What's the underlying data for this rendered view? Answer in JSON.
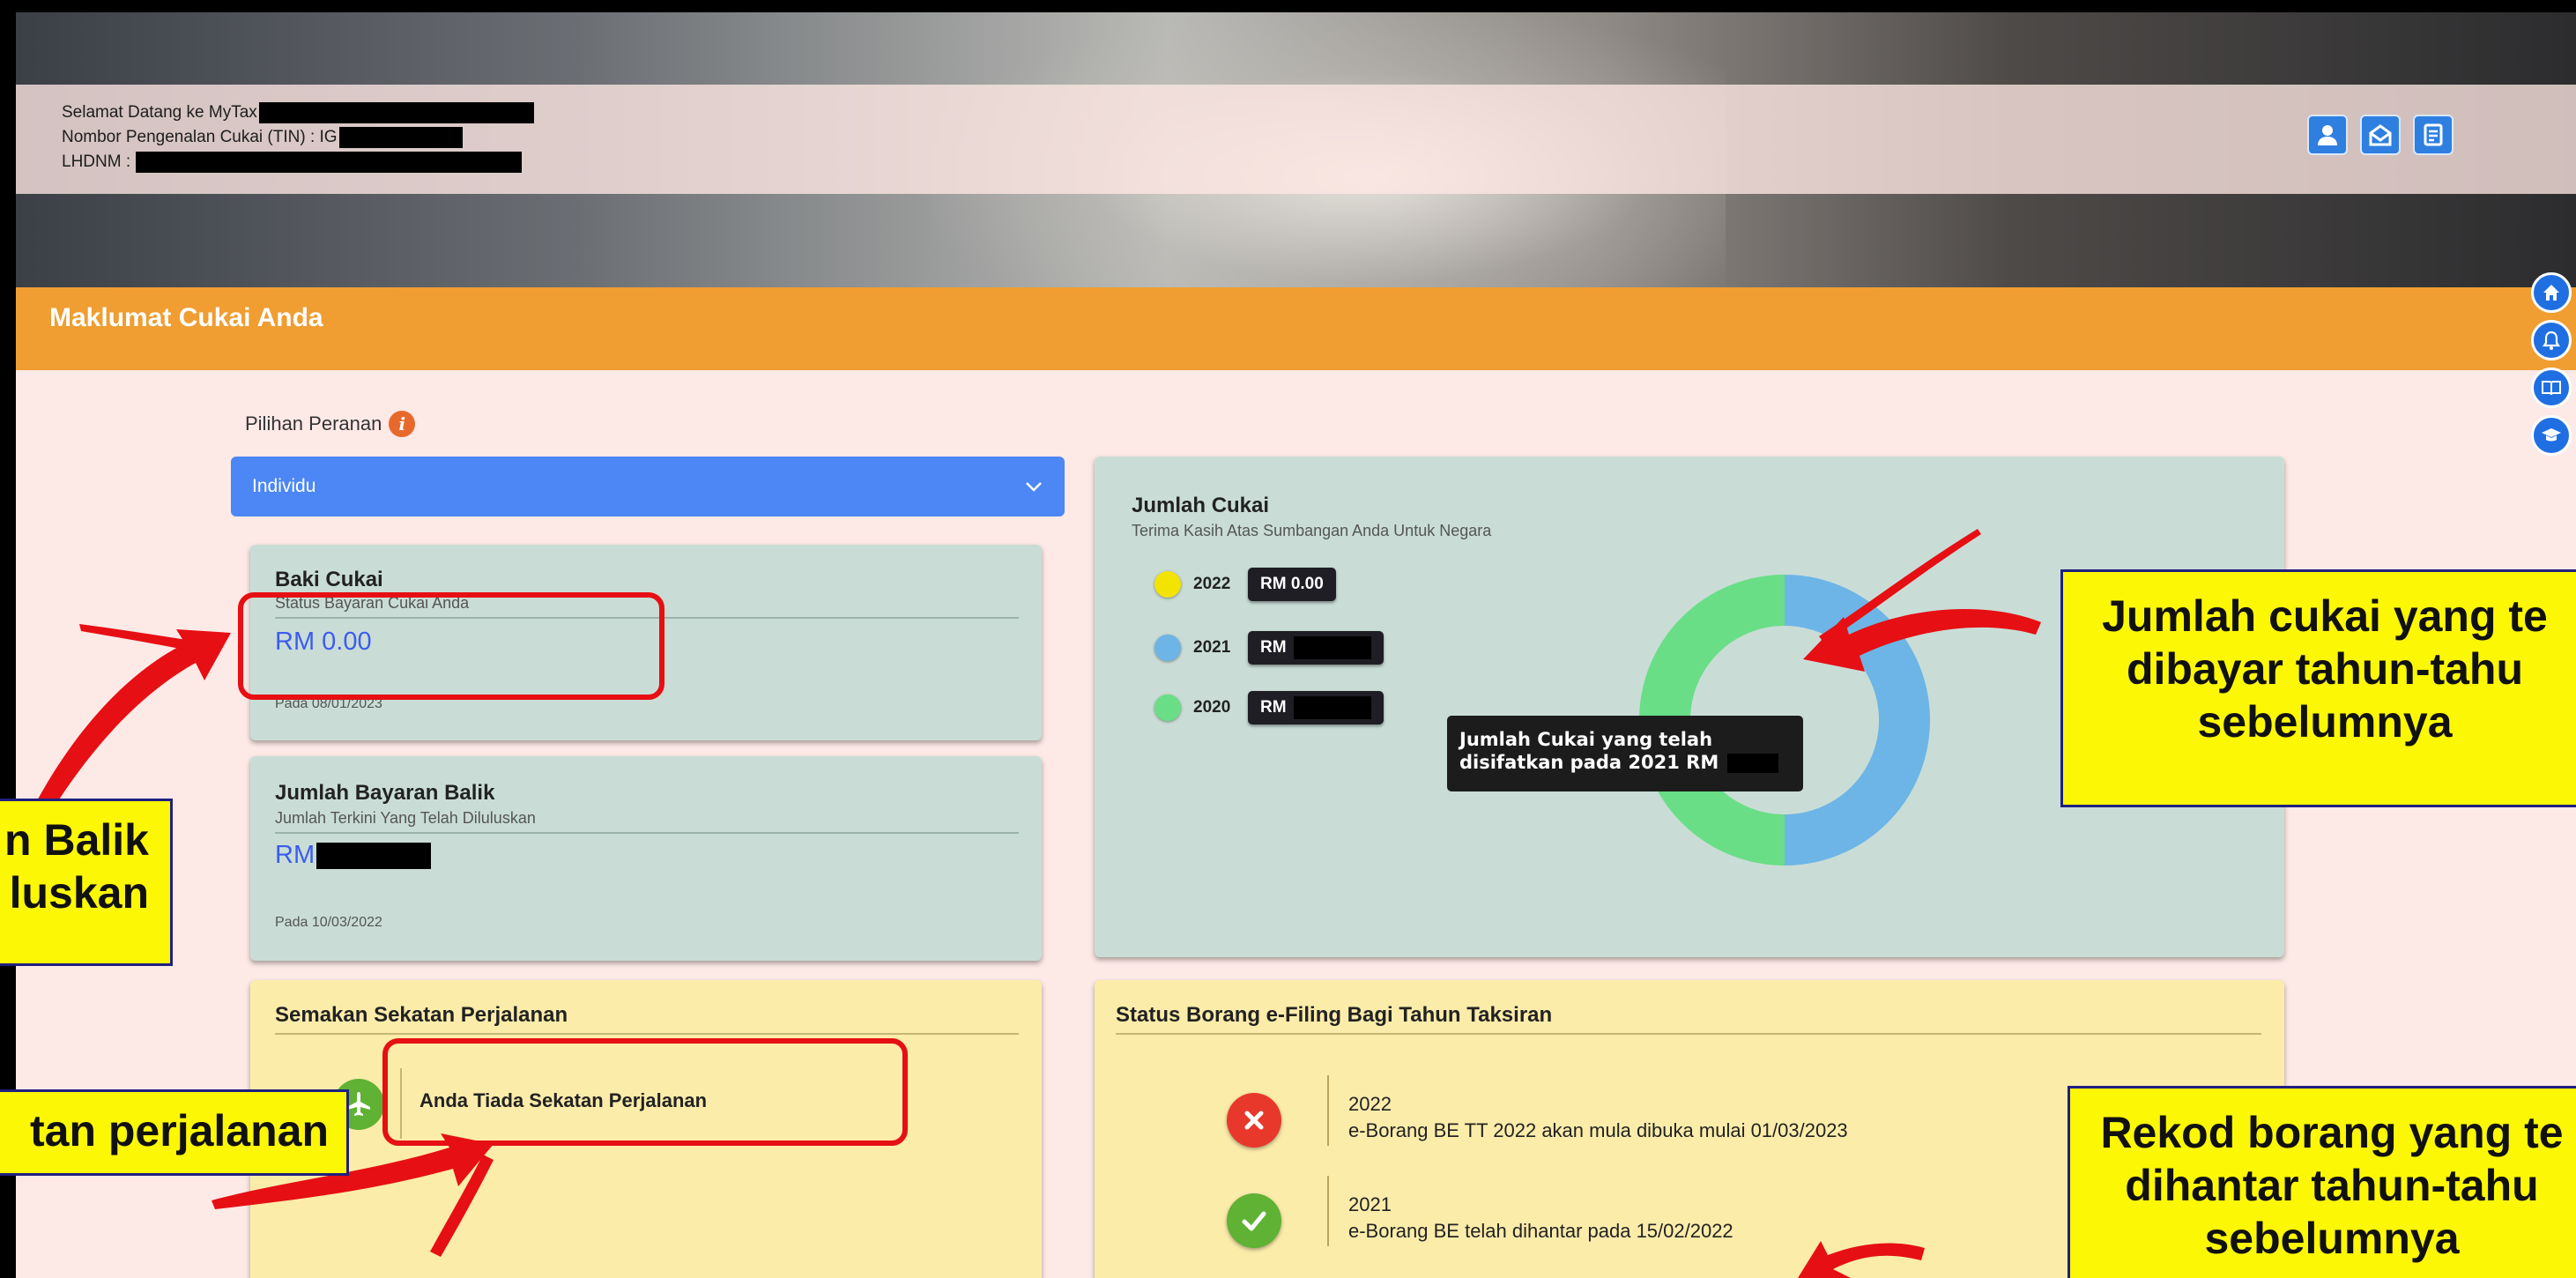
{
  "header": {
    "welcome_label": "Selamat Datang ke MyTax",
    "tin_label": "Nombor Pengenalan Cukai (TIN) : IG",
    "lhdnm_label": "LHDNM :"
  },
  "section_title": "Maklumat Cukai Anda",
  "role": {
    "label": "Pilihan Peranan",
    "info_glyph": "i",
    "selected": "Individu"
  },
  "baki": {
    "title": "Baki Cukai",
    "subtitle": "Status Bayaran Cukai Anda",
    "value": "RM 0.00",
    "date": "Pada 08/01/2023"
  },
  "bayaran": {
    "title": "Jumlah Bayaran Balik",
    "subtitle": "Jumlah Terkini Yang Telah Diluluskan",
    "value": "RM",
    "date": "Pada 10/03/2022"
  },
  "jumlah_cukai": {
    "title": "Jumlah Cukai",
    "subtitle": "Terima Kasih Atas Sumbangan Anda Untuk Negara",
    "tooltip": "Jumlah Cukai yang telah disifatkan pada 2021 RM"
  },
  "chart_data": {
    "type": "pie",
    "categories": [
      "2022",
      "2021",
      "2020"
    ],
    "labels": [
      "RM 0.00",
      "RM",
      "RM"
    ],
    "values": [
      0,
      0.5,
      0.5
    ],
    "colors": [
      "#f2e400",
      "#6db5e6",
      "#69de86"
    ],
    "donut": true
  },
  "sekatan": {
    "title": "Semakan Sekatan Perjalanan",
    "message": "Anda Tiada Sekatan Perjalanan"
  },
  "efiling": {
    "title": "Status Borang e-Filing Bagi Tahun Taksiran",
    "rows": [
      {
        "year": "2022",
        "text": "e-Borang BE TT 2022 akan mula dibuka mulai 01/03/2023",
        "status": "not-open"
      },
      {
        "year": "2021",
        "text": "e-Borang BE telah dihantar pada 15/02/2022",
        "status": "submitted"
      }
    ]
  },
  "callouts": {
    "jumlah": "Jumlah cukai yang te\ndibayar tahun-tahu\nsebelumnya",
    "rekod": "Rekod borang yang te\ndihantar tahun-tahu\nsebelumnya",
    "balik": "n Balik\nluskan",
    "sekatan": "tan perjalanan"
  },
  "colors": {
    "accent_orange": "#f09d31",
    "select_blue": "#4c87f5",
    "value_blue": "#3c5cf0",
    "callout_yellow": "#fcf705",
    "highlight_red": "#e60f14"
  }
}
